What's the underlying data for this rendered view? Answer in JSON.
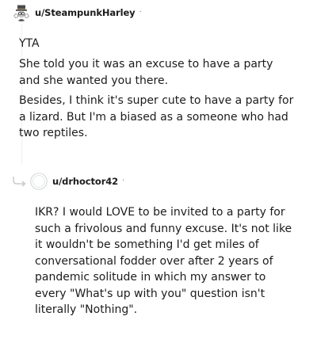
{
  "colors": {
    "text": "#1c1c1c",
    "meta": "#7c7c7c",
    "avatar_ring": "#d7dadc"
  },
  "comment1": {
    "username": "u/SteampunkHarley",
    "separator": "·",
    "avatar_icon": "steampunk-avatar-icon",
    "paragraphs": [
      "YTA",
      "She told you it was an excuse to have a party and she wanted you there.",
      "Besides, I think it's super cute to have a party for a lizard. But I'm a biased as a someone who had two reptiles."
    ]
  },
  "comment2": {
    "username": "u/drhoctor42",
    "separator": "·",
    "reply_icon": "reply-arrow-icon",
    "avatar_icon": "default-avatar-icon",
    "paragraphs": [
      "IKR? I would LOVE to be invited to a party for such a frivolous and funny excuse. It's not like it wouldn't be something I'd get miles of conversational fodder over after 2 years of pandemic solitude in which my answer to every \"What's up with you\" question isn't literally \"Nothing\"."
    ]
  }
}
